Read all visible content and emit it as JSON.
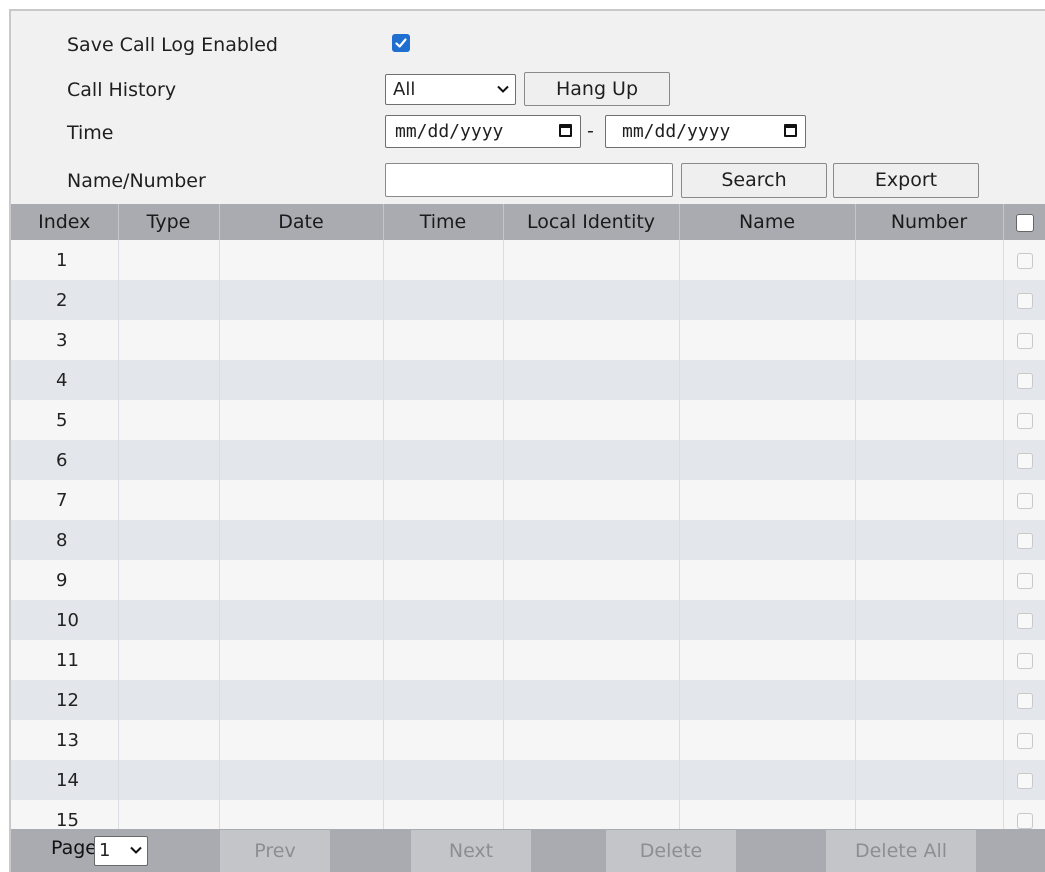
{
  "form": {
    "save_call_log_label": "Save Call Log Enabled",
    "save_call_log_checked": true,
    "call_history_label": "Call History",
    "call_history_selected": "All",
    "hang_up_label": "Hang Up",
    "time_label": "Time",
    "date_from_placeholder": "mm/dd/yyyy",
    "date_separator": "-",
    "date_to_placeholder": "mm/dd/yyyy",
    "name_number_label": "Name/Number",
    "name_number_value": "",
    "search_label": "Search",
    "export_label": "Export"
  },
  "table": {
    "columns": [
      "Index",
      "Type",
      "Date",
      "Time",
      "Local Identity",
      "Name",
      "Number"
    ],
    "rows": [
      "1",
      "2",
      "3",
      "4",
      "5",
      "6",
      "7",
      "8",
      "9",
      "10",
      "11",
      "12",
      "13",
      "14",
      "15"
    ]
  },
  "footer": {
    "page_label": "Page",
    "page_selected": "1",
    "prev_label": "Prev",
    "next_label": "Next",
    "delete_label": "Delete",
    "delete_all_label": "Delete All"
  },
  "colors": {
    "header_bg": "#a9abb0",
    "row_odd": "#f6f6f6",
    "row_even": "#e3e6ea",
    "checkbox_accent": "#1f6fd1"
  }
}
